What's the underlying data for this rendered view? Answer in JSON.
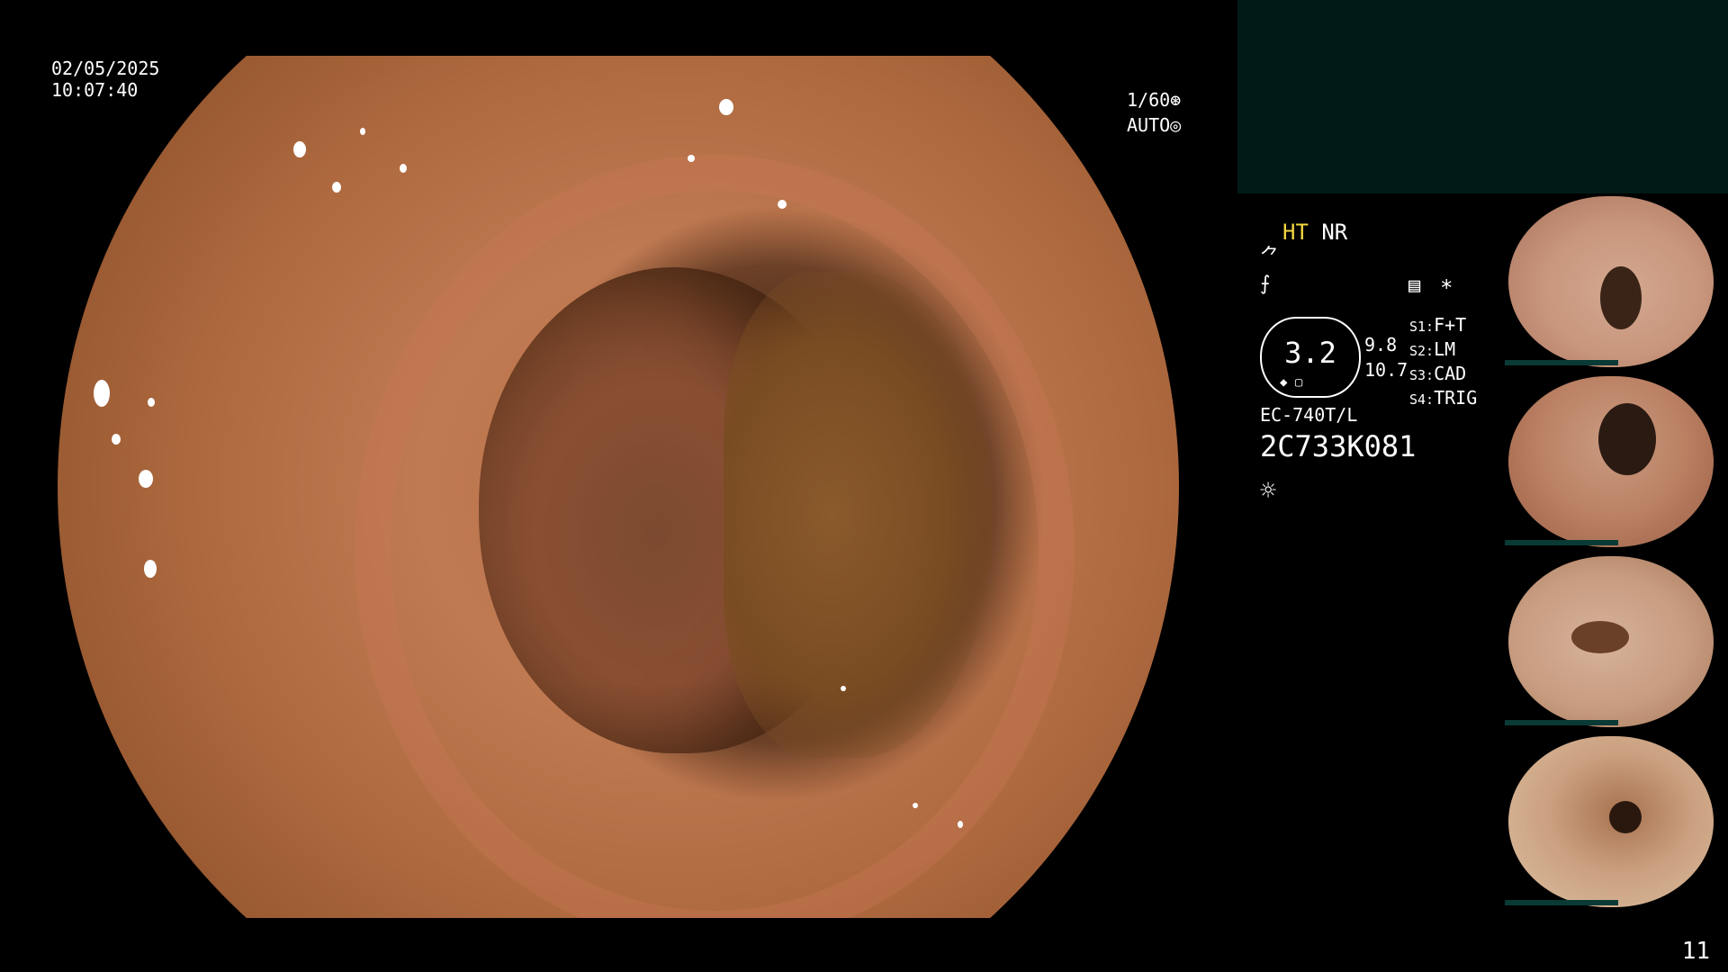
{
  "datetime": {
    "date": "02/05/2025",
    "time": "10:07:40"
  },
  "camera": {
    "shutter": "1/60",
    "shutter_icon": "aperture-icon",
    "mode": "AUTO",
    "mode_icon": "iris-icon"
  },
  "status": {
    "ht": "HT",
    "nr": "NR",
    "icon1": "⺈",
    "icon2": "⨍",
    "memo_icon": "▤",
    "star": "*",
    "gauge_value": "3.2",
    "gauge_small_1": "9.8",
    "gauge_small_2": "10.7",
    "scope_model": "EC-740T/L",
    "serial": "2C733K081",
    "light_icon": "☼"
  },
  "switches": [
    {
      "key": "S1:",
      "value": "F+T"
    },
    {
      "key": "S2:",
      "value": "LM"
    },
    {
      "key": "S3:",
      "value": "CAD"
    },
    {
      "key": "S4:",
      "value": "TRIG"
    }
  ],
  "page_number": "11",
  "colors": {
    "background": "#000000",
    "panel": "#021a17",
    "accent_yellow": "#f2d640"
  }
}
